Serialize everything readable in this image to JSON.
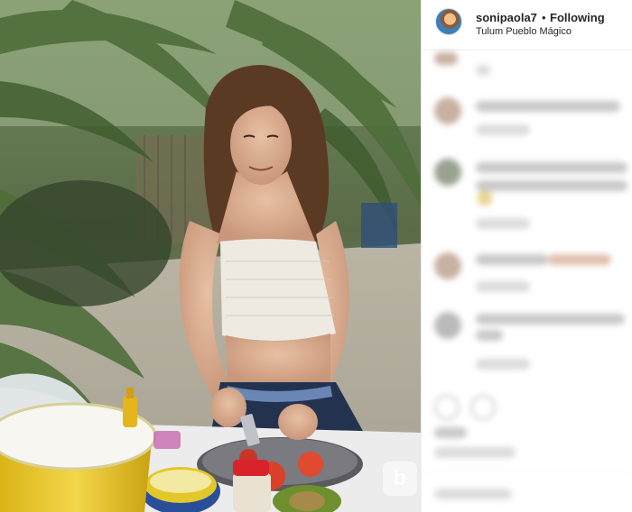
{
  "post": {
    "username": "sonipaola7",
    "separator": "•",
    "follow_status": "Following",
    "location": "Tulum Pueblo Mágico"
  },
  "icons": {
    "avatar": "profile-avatar",
    "like": "heart-icon",
    "comment": "comment-icon",
    "watermark": "watermark-logo"
  },
  "colors": {
    "text": "#262626",
    "divider": "#efefef",
    "background": "#ffffff"
  }
}
